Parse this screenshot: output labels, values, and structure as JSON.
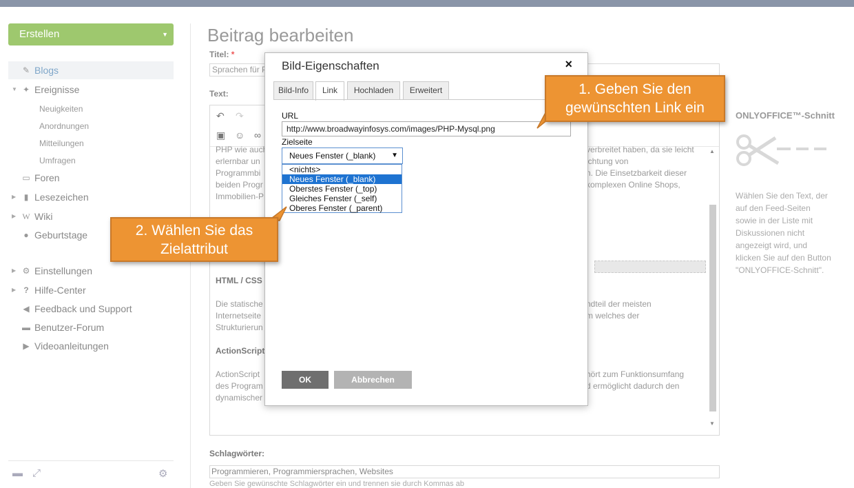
{
  "sidebar": {
    "create_label": "Erstellen",
    "items": [
      {
        "label": "Blogs",
        "icon": "edit-icon"
      },
      {
        "label": "Ereignisse",
        "icon": "pin-icon"
      },
      {
        "label": "Foren",
        "icon": "chat-icon"
      },
      {
        "label": "Lesezeichen",
        "icon": "bookmark-icon"
      },
      {
        "label": "Wiki",
        "icon": "wiki-icon"
      },
      {
        "label": "Geburtstage",
        "icon": "people-icon"
      },
      {
        "label": "Einstellungen",
        "icon": "gear-icon"
      },
      {
        "label": "Hilfe-Center",
        "icon": "question-icon"
      },
      {
        "label": "Feedback und Support",
        "icon": "megaphone-icon"
      },
      {
        "label": "Benutzer-Forum",
        "icon": "speech-icon"
      },
      {
        "label": "Videoanleitungen",
        "icon": "play-icon"
      }
    ],
    "subitems": [
      "Neuigkeiten",
      "Anordnungen",
      "Mitteilungen",
      "Umfragen"
    ]
  },
  "main": {
    "page_title": "Beitrag bearbeiten",
    "title_label": "Titel:",
    "required_mark": "*",
    "title_value": "Sprachen für P",
    "text_label": "Text:",
    "body": {
      "p1": "PHP wie auch ... verbreitet haben, da sie leicht erlernbar un... ichtung von Programmbi... n. Die Einsetzbarkeit dieser beiden Progr... komplexen Online Shops, Immobilien-P...",
      "p1_left_lines": [
        "PHP wie auch",
        "erlernbar un",
        "Programmbi",
        "beiden Progr",
        "Immobilien-P"
      ],
      "p1_right_lines": [
        "verbreitet haben, da sie leicht",
        "ichtung von",
        "n. Die Einsetzbarkeit dieser",
        "komplexen Online Shops,",
        ""
      ],
      "h2": "HTML / CSS",
      "p2_left_lines": [
        "Die statische",
        "Internetseite",
        "Strukturierun"
      ],
      "p2_right_lines": [
        "ndteil der meisten",
        "m welches der",
        ""
      ],
      "h3": "ActionScript",
      "p3_left_lines": [
        "ActionScript",
        "des Program",
        "dynamischer"
      ],
      "p3_right_lines": [
        "hört zum Funktionsumfang",
        "d ermöglicht dadurch den",
        ""
      ]
    },
    "tags_label": "Schlagwörter:",
    "tags_value": "Programmieren, Programmiersprachen, Websites",
    "tags_hint": "Geben Sie gewünschte Schlagwörter ein und trennen sie durch Kommas ab"
  },
  "right_panel": {
    "title": "ONLYOFFICE™-Schnitt",
    "text": "Wählen Sie den Text, der auf den Feed-Seiten sowie in der Liste mit Diskussionen nicht angezeigt wird, und klicken Sie auf den Button \"ONLYOFFICE-Schnitt\"."
  },
  "dialog": {
    "title": "Bild-Eigenschaften",
    "close": "×",
    "tabs": [
      "Bild-Info",
      "Link",
      "Hochladen",
      "Erweitert"
    ],
    "active_tab": "Link",
    "url_label": "URL",
    "url_value": "http://www.broadwayinfosys.com/images/PHP-Mysql.png",
    "target_label": "Zielseite",
    "target_selected": "Neues Fenster (_blank)",
    "target_options": [
      "<nichts>",
      "Neues Fenster (_blank)",
      "Oberstes Fenster (_top)",
      "Gleiches Fenster (_self)",
      "Oberes Fenster (_parent)"
    ],
    "ok_label": "OK",
    "cancel_label": "Abbrechen"
  },
  "callouts": {
    "c1_line1": "1. Geben Sie den",
    "c1_line2": "gewünschten Link ein",
    "c2_line1": "2. Wählen Sie das",
    "c2_line2": "Zielattribut"
  },
  "colors": {
    "create_button": "#9ec86e",
    "active_nav": "#7ea6c9",
    "callout": "#ed9433",
    "selected_option": "#1e73d1"
  }
}
